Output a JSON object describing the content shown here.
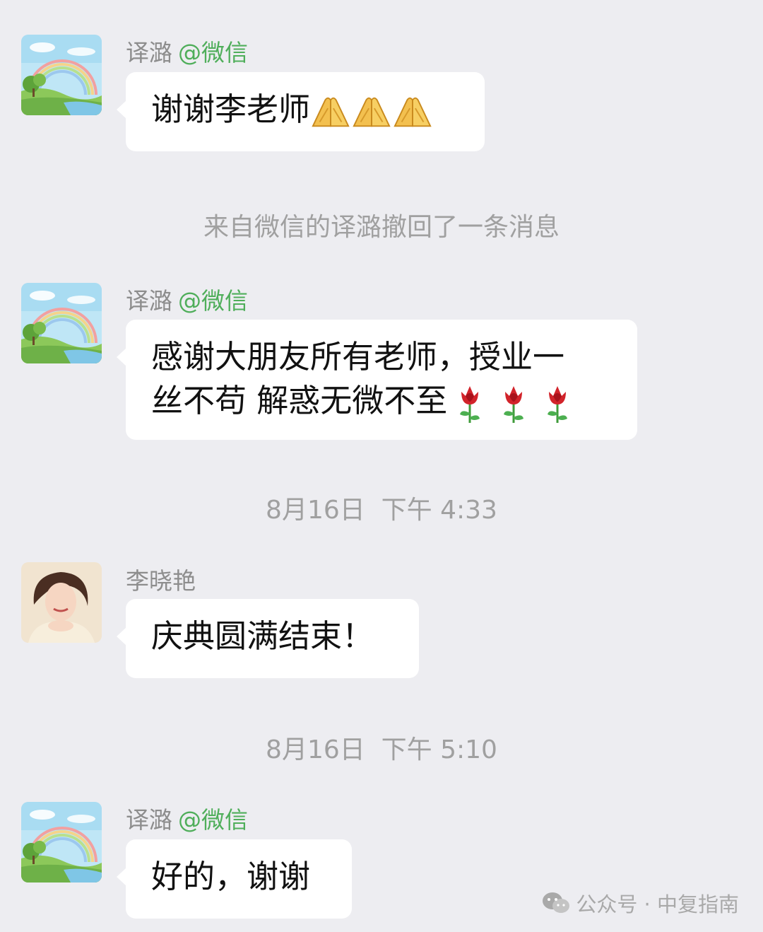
{
  "messages": [
    {
      "sender": "译潞",
      "tag": "@微信",
      "text": "谢谢李老师",
      "emoji": "folded-hands-icon"
    },
    {
      "system": "来自微信的译潞撤回了一条消息"
    },
    {
      "sender": "译潞",
      "tag": "@微信",
      "line1": "感谢大朋友所有老师，授业一",
      "line2": "丝不苟 解惑无微不至",
      "emoji": "rose-icon"
    },
    {
      "time": "8月16日  下午 4:33"
    },
    {
      "sender": "李晓艳",
      "text": "庆典圆满结束！"
    },
    {
      "time": "8月16日  下午 5:10"
    },
    {
      "sender": "译潞",
      "tag": "@微信",
      "text": "好的，谢谢"
    }
  ],
  "watermark": {
    "text": "公众号 · 中复指南",
    "icon": "wechat-icon"
  },
  "colors": {
    "background": "#ededf1",
    "bubble": "#ffffff",
    "tag": "#4fae5a",
    "meta": "#a0a0a0"
  }
}
